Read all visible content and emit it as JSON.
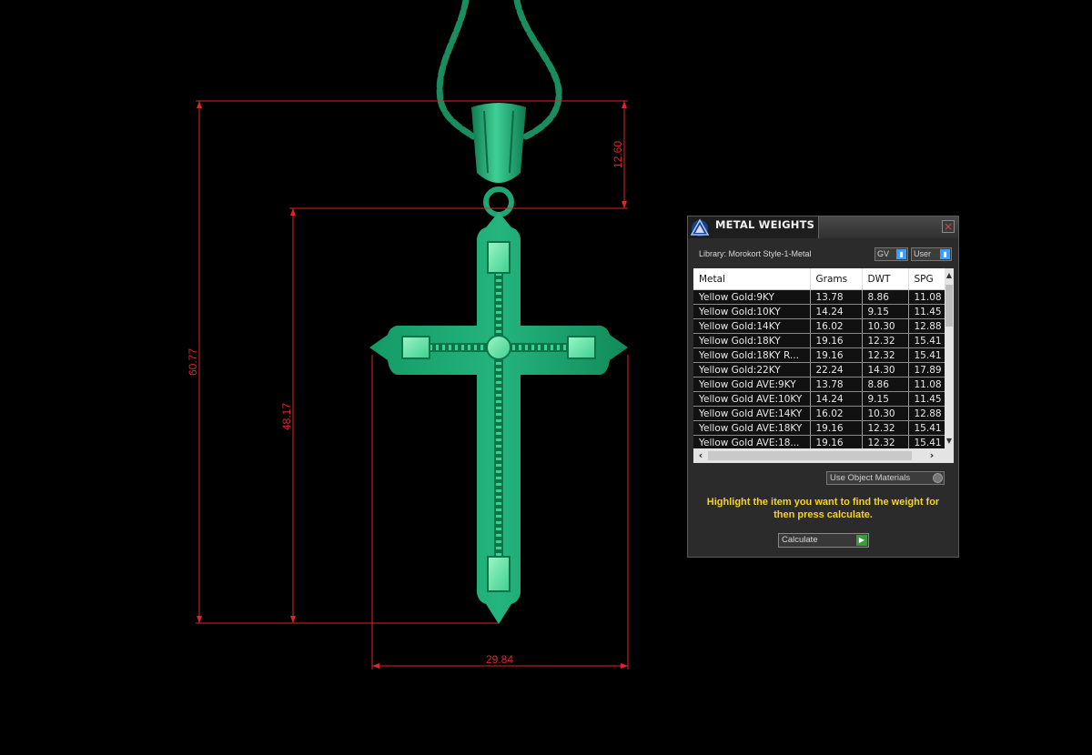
{
  "dimensions": {
    "total_height": "60.77",
    "body_height": "48.17",
    "bail_height": "12.60",
    "width": "29.84"
  },
  "colors": {
    "model": "#1fa673",
    "model_highlight": "#5fe0a4",
    "dimension_line": "#e0242a",
    "panel_bg": "#2b2b2b",
    "instruction_text": "#f5d327"
  },
  "panel": {
    "title": "METAL WEIGHTS",
    "logo_icon": "triangle-logo-icon",
    "close_label": "×",
    "library_label": "Library: Morokort Style-1-Metal",
    "gv_select": "GV",
    "user_select": "User",
    "columns": [
      "Metal",
      "Grams",
      "DWT",
      "SPG"
    ],
    "rows": [
      [
        "Yellow Gold:9KY",
        "13.78",
        "8.86",
        "11.08"
      ],
      [
        "Yellow Gold:10KY",
        "14.24",
        "9.15",
        "11.45"
      ],
      [
        "Yellow Gold:14KY",
        "16.02",
        "10.30",
        "12.88"
      ],
      [
        "Yellow Gold:18KY",
        "19.16",
        "12.32",
        "15.41"
      ],
      [
        "Yellow Gold:18KY R...",
        "19.16",
        "12.32",
        "15.41"
      ],
      [
        "Yellow Gold:22KY",
        "22.24",
        "14.30",
        "17.89"
      ],
      [
        "Yellow Gold AVE:9KY",
        "13.78",
        "8.86",
        "11.08"
      ],
      [
        "Yellow Gold AVE:10KY",
        "14.24",
        "9.15",
        "11.45"
      ],
      [
        "Yellow Gold AVE:14KY",
        "16.02",
        "10.30",
        "12.88"
      ],
      [
        "Yellow Gold AVE:18KY",
        "19.16",
        "12.32",
        "15.41"
      ],
      [
        "Yellow Gold AVE:18...",
        "19.16",
        "12.32",
        "15.41"
      ]
    ],
    "use_object_materials": "Use Object Materials",
    "instruction": "Highlight the item you want to find the weight for then press calculate.",
    "calculate_label": "Calculate"
  }
}
